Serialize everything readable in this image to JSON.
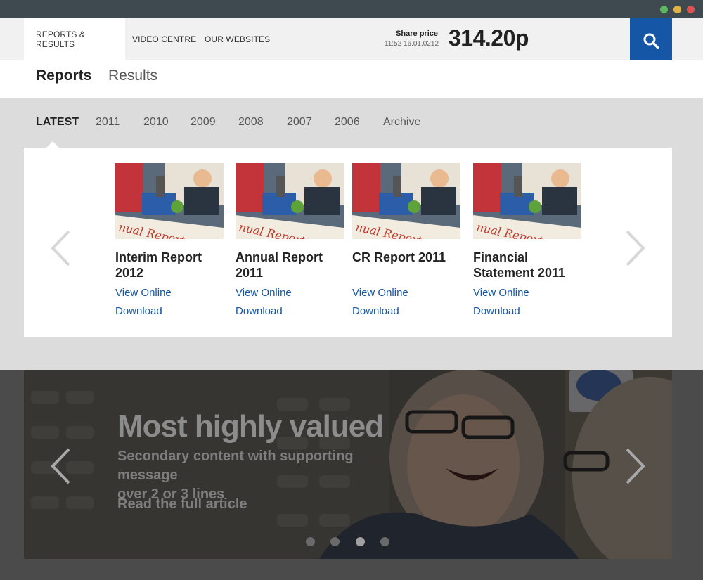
{
  "nav": {
    "tabs": [
      {
        "label": "REPORTS & RESULTS"
      },
      {
        "label": "VIDEO CENTRE"
      },
      {
        "label": "OUR WEBSITES"
      }
    ],
    "share": {
      "label": "Share price",
      "time": "11:52 16.01.0212",
      "price": "314.20p"
    }
  },
  "subnav": {
    "tabs": [
      {
        "label": "Reports"
      },
      {
        "label": "Results"
      }
    ]
  },
  "years": {
    "items": [
      {
        "label": "LATEST"
      },
      {
        "label": "2011"
      },
      {
        "label": "2010"
      },
      {
        "label": "2009"
      },
      {
        "label": "2008"
      },
      {
        "label": "2007"
      },
      {
        "label": "2006"
      },
      {
        "label": "Archive"
      }
    ]
  },
  "reports": {
    "link_color": "#1656a6",
    "items": [
      {
        "title_line1": "Interim Report",
        "title_line2": "2012",
        "view": "View Online",
        "download": "Download"
      },
      {
        "title_line1": "Annual Report",
        "title_line2": "2011",
        "view": "View Online",
        "download": "Download"
      },
      {
        "title_line1": "CR Report 2011",
        "title_line2": "",
        "view": "View Online",
        "download": "Download"
      },
      {
        "title_line1": "Financial",
        "title_line2": "Statement 2011",
        "view": "View Online",
        "download": "Download"
      }
    ],
    "cover_text": "nual Report"
  },
  "hero": {
    "title": "Most highly valued",
    "subtitle_line1": "Secondary content with supporting message",
    "subtitle_line2": "over 2 or 3 lines",
    "link": "Read the full article",
    "active_slide": 3,
    "slide_count": 4
  },
  "colors": {
    "accent": "#1656a6",
    "panel_bg": "#dcdcdc"
  }
}
